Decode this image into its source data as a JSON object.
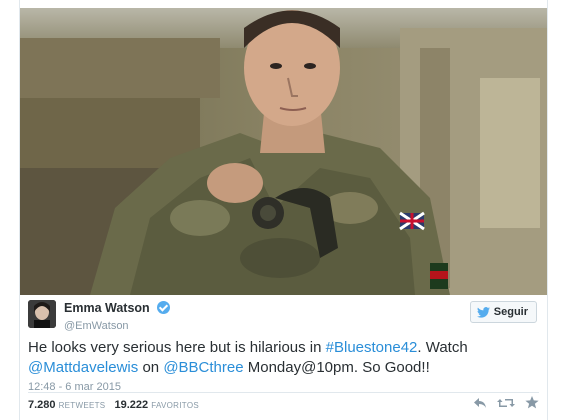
{
  "tweet": {
    "author": {
      "display_name": "Emma Watson",
      "screen_name": "@EmWatson",
      "verified": true
    },
    "follow_label": "Seguir",
    "text_segments": [
      {
        "text": "He looks very serious here but is hilarious in ",
        "link": false
      },
      {
        "text": "#Bluestone42",
        "link": true
      },
      {
        "text": ". Watch ",
        "link": false
      },
      {
        "text": "@Mattdavelewis",
        "link": true
      },
      {
        "text": " on ",
        "link": false
      },
      {
        "text": "@BBCthree",
        "link": true
      },
      {
        "text": " Monday@10pm. So Good!!",
        "link": false
      }
    ],
    "timestamp": "12:48 - 6 mar 2015",
    "retweets_count": "7.280",
    "retweets_label": "RETWEETS",
    "favorites_count": "19.222",
    "favorites_label": "FAVORITOS"
  },
  "icons": {
    "verified": "verified-badge-icon",
    "follow": "twitter-bird-icon",
    "reply": "reply-icon",
    "retweet": "retweet-icon",
    "favorite": "star-icon"
  },
  "colors": {
    "link": "#2a8ed8",
    "verified": "#55acee",
    "text": "#292f33",
    "muted": "#8899a6"
  }
}
